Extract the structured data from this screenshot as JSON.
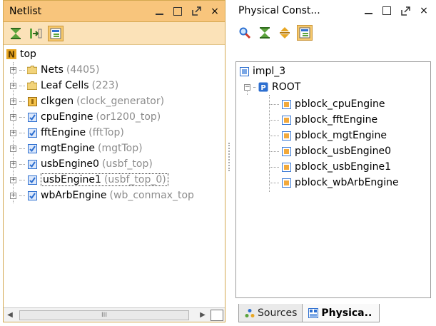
{
  "netlist": {
    "title": "Netlist",
    "tree": {
      "root": "top",
      "items": [
        {
          "name": "Nets",
          "detail": "(4405)",
          "icon": "folder-icon"
        },
        {
          "name": "Leaf Cells",
          "detail": "(223)",
          "icon": "folder-icon"
        },
        {
          "name": "clkgen",
          "detail": "(clock_generator)",
          "icon": "cell-icon"
        },
        {
          "name": "cpuEngine",
          "detail": "(or1200_top)",
          "icon": "hier-cell-icon"
        },
        {
          "name": "fftEngine",
          "detail": "(fftTop)",
          "icon": "hier-cell-icon"
        },
        {
          "name": "mgtEngine",
          "detail": "(mgtTop)",
          "icon": "hier-cell-icon"
        },
        {
          "name": "usbEngine0",
          "detail": "(usbf_top)",
          "icon": "hier-cell-icon"
        },
        {
          "name": "usbEngine1",
          "detail": "(usbf_top_0)",
          "icon": "hier-cell-icon"
        },
        {
          "name": "wbArbEngine",
          "detail": "(wb_conmax_top",
          "icon": "hier-cell-icon"
        }
      ]
    },
    "scroll_grip": "III"
  },
  "physical": {
    "title": "Physical Const...",
    "tree": {
      "root": "impl_3",
      "group": "ROOT",
      "items": [
        "pblock_cpuEngine",
        "pblock_fftEngine",
        "pblock_mgtEngine",
        "pblock_usbEngine0",
        "pblock_usbEngine1",
        "pblock_wbArbEngine"
      ]
    },
    "tabs": [
      {
        "label": "Sources",
        "active": false
      },
      {
        "label": "Physica..",
        "active": true
      }
    ]
  },
  "window_buttons": {
    "close": "×"
  },
  "colors": {
    "netlist_title_bg": "#f8c57c",
    "netlist_toolbar_bg": "#fbe2b8",
    "active_toggle": "#f6c86c",
    "detail_gray": "#8c8c8c",
    "pblock_icon": "#f2a93b",
    "hier_icon": "#2d6fd0"
  }
}
